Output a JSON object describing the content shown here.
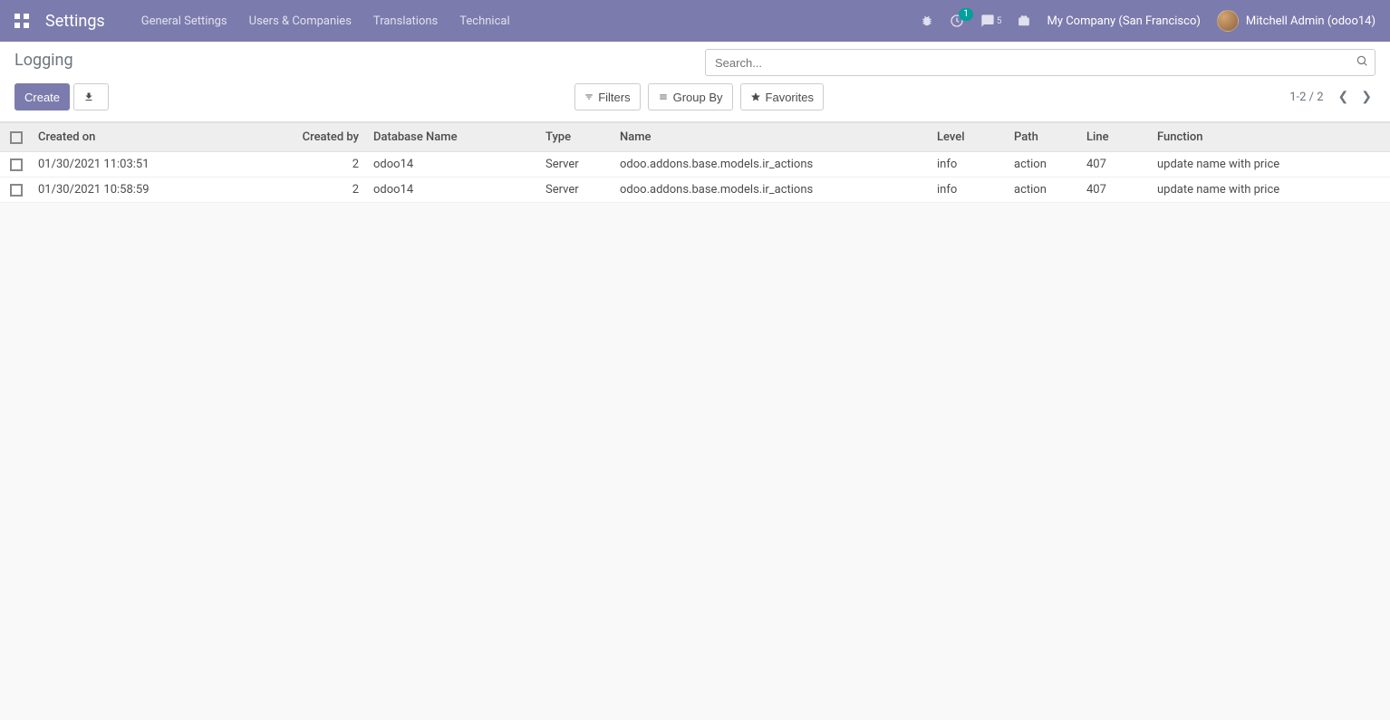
{
  "topnav": {
    "app_title": "Settings",
    "menu": [
      "General Settings",
      "Users & Companies",
      "Translations",
      "Technical"
    ],
    "activity_badge": "1",
    "chat_badge": "5",
    "company": "My Company (San Francisco)",
    "user": "Mitchell Admin (odoo14)"
  },
  "control_panel": {
    "breadcrumb": "Logging",
    "search_placeholder": "Search...",
    "create_label": "Create",
    "filters_label": "Filters",
    "groupby_label": "Group By",
    "favorites_label": "Favorites",
    "pager": "1-2 / 2"
  },
  "table": {
    "headers": {
      "created_on": "Created on",
      "created_by": "Created by",
      "database_name": "Database Name",
      "type": "Type",
      "name": "Name",
      "level": "Level",
      "path": "Path",
      "line": "Line",
      "function": "Function"
    },
    "rows": [
      {
        "created_on": "01/30/2021 11:03:51",
        "created_by": "2",
        "database_name": "odoo14",
        "type": "Server",
        "name": "odoo.addons.base.models.ir_actions",
        "level": "info",
        "path": "action",
        "line": "407",
        "function": "update name with price"
      },
      {
        "created_on": "01/30/2021 10:58:59",
        "created_by": "2",
        "database_name": "odoo14",
        "type": "Server",
        "name": "odoo.addons.base.models.ir_actions",
        "level": "info",
        "path": "action",
        "line": "407",
        "function": "update name with price"
      }
    ]
  }
}
